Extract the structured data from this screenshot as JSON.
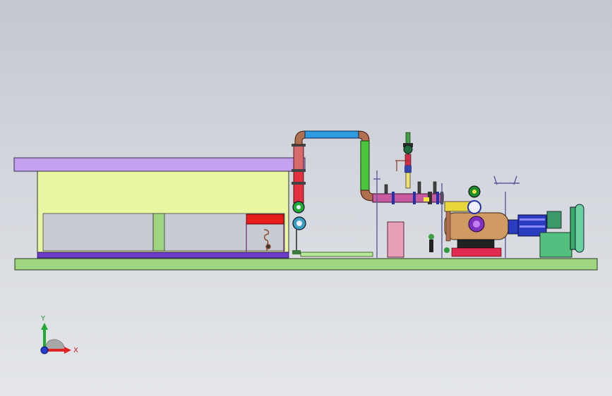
{
  "view": {
    "background_top": "#c3c7cf",
    "background_bottom": "#e4e6ea"
  },
  "model": {
    "base_color": "#9fd580",
    "roof_color": "#c4a2f0",
    "cabinet_color": "#e9f6a2",
    "pipe_blue": "#2e9be0",
    "pipe_green": "#4ac43c",
    "pipe_red": "#e23040",
    "tank_color": "#cf9b62",
    "motor_color": "#2a3cc0",
    "icons": [
      "pipe-elbow-icon",
      "valve-icon",
      "pressure-gauge-icon",
      "motor-icon",
      "tank-icon"
    ]
  },
  "triad": {
    "x_label": "X",
    "y_label": "Y",
    "x_color": "#e02424",
    "y_color": "#22aa33",
    "z_color": "#2a3cd0"
  }
}
